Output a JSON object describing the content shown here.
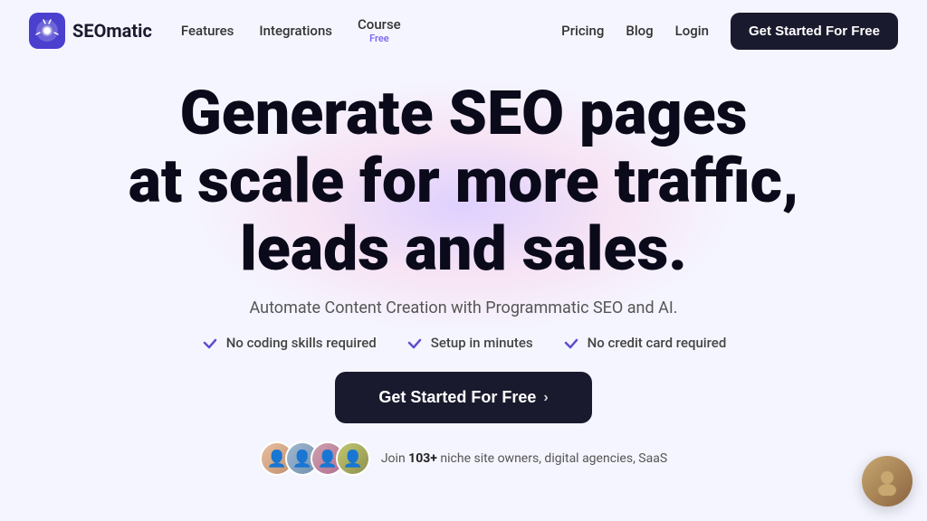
{
  "brand": {
    "name": "SEOmatic",
    "logo_alt": "SEOmatic logo"
  },
  "navbar": {
    "links": [
      {
        "label": "Features",
        "id": "features"
      },
      {
        "label": "Integrations",
        "id": "integrations"
      },
      {
        "label": "Course",
        "id": "course",
        "badge": "Free"
      },
      {
        "label": "Pricing",
        "id": "pricing"
      },
      {
        "label": "Blog",
        "id": "blog"
      },
      {
        "label": "Login",
        "id": "login"
      }
    ],
    "cta_label": "Get Started For Free"
  },
  "hero": {
    "title_line1": "Generate SEO pages",
    "title_line2": "at scale for more traffic,",
    "title_line3": "leads and sales.",
    "subtitle": "Automate Content Creation with Programmatic SEO and AI.",
    "features": [
      {
        "label": "No coding skills required"
      },
      {
        "label": "Setup in minutes"
      },
      {
        "label": "No credit card required"
      }
    ],
    "cta_label": "Get Started For Free",
    "cta_arrow": "›"
  },
  "social_proof": {
    "prefix": "Join",
    "count": "103+",
    "suffix": "niche site owners, digital agencies, SaaS"
  },
  "colors": {
    "bg": "#f5f5ff",
    "dark": "#1a1a2e",
    "purple": "#5b4fcf",
    "accent_glow": "rgba(180, 140, 255, 0.35)"
  }
}
